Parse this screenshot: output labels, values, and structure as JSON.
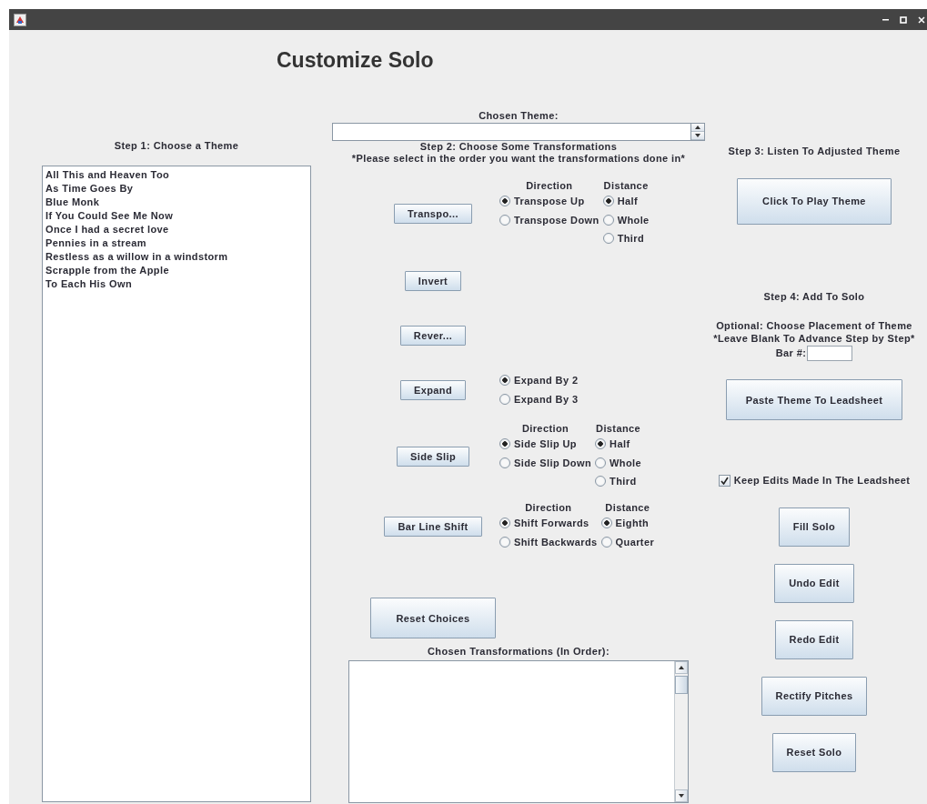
{
  "window": {
    "title": "Customize Solo"
  },
  "step1": {
    "label": "Step 1: Choose a Theme",
    "themes": [
      {
        "label": "All This and Heaven Too",
        "selected": false
      },
      {
        "label": "As Time Goes By",
        "selected": false
      },
      {
        "label": "Blue Monk",
        "selected": false
      },
      {
        "label": "If You Could See Me Now",
        "selected": false
      },
      {
        "label": "Once I had a secret love",
        "selected": false
      },
      {
        "label": "Pennies in a stream",
        "selected": false
      },
      {
        "label": "Restless as a willow in a windstorm",
        "selected": false
      },
      {
        "label": "Scrapple from the Apple",
        "selected": false
      },
      {
        "label": "To Each His Own",
        "selected": false
      }
    ]
  },
  "chosen_theme": {
    "label": "Chosen Theme:"
  },
  "step2": {
    "label": "Step 2: Choose Some Transformations",
    "note": "*Please select in the order you want the transformations done in*",
    "transformations": [
      {
        "button": "Transpo...",
        "groups": [
          {
            "heading": "Direction",
            "choices": [
              {
                "label": "Transpose Up",
                "selected": true
              },
              {
                "label": "Transpose Down",
                "selected": false
              }
            ]
          },
          {
            "heading": "Distance",
            "choices": [
              {
                "label": "Half",
                "selected": true
              },
              {
                "label": "Whole",
                "selected": false
              },
              {
                "label": "Third",
                "selected": false
              }
            ]
          }
        ]
      },
      {
        "button": "Invert"
      },
      {
        "button": "Rever..."
      },
      {
        "button": "Expand",
        "groups": [
          {
            "choices": [
              {
                "label": "Expand By 2",
                "selected": true
              },
              {
                "label": "Expand By 3",
                "selected": false
              }
            ]
          }
        ]
      },
      {
        "button": "Side Slip",
        "groups": [
          {
            "heading": "Direction",
            "choices": [
              {
                "label": "Side Slip Up",
                "selected": true
              },
              {
                "label": "Side Slip Down",
                "selected": false
              }
            ]
          },
          {
            "heading": "Distance",
            "choices": [
              {
                "label": "Half",
                "selected": true
              },
              {
                "label": "Whole",
                "selected": false
              },
              {
                "label": "Third",
                "selected": false
              }
            ]
          }
        ]
      },
      {
        "button": "Bar Line Shift",
        "groups": [
          {
            "heading": "Direction",
            "choices": [
              {
                "label": "Shift Forwards",
                "selected": true
              },
              {
                "label": "Shift Backwards",
                "selected": false
              }
            ]
          },
          {
            "heading": "Distance",
            "choices": [
              {
                "label": "Eighth",
                "selected": true
              },
              {
                "label": "Quarter",
                "selected": false
              }
            ]
          }
        ]
      }
    ],
    "reset_button": "Reset Choices",
    "chosen_label": "Chosen Transformations (In Order):"
  },
  "step3": {
    "label": "Step 3: Listen To Adjusted Theme",
    "play_button": "Click To Play Theme"
  },
  "step4": {
    "label": "Step 4: Add To Solo",
    "placement_label": "Optional: Choose Placement of Theme",
    "placement_note": "*Leave Blank To Advance Step by Step*",
    "bar_label": "Bar #:",
    "paste_button": "Paste Theme To Leadsheet",
    "keep_edits": {
      "label": "Keep Edits Made In The Leadsheet",
      "checked": true
    },
    "buttons": [
      "Fill Solo",
      "Undo Edit",
      "Redo Edit",
      "Rectify Pitches",
      "Reset Solo"
    ]
  }
}
